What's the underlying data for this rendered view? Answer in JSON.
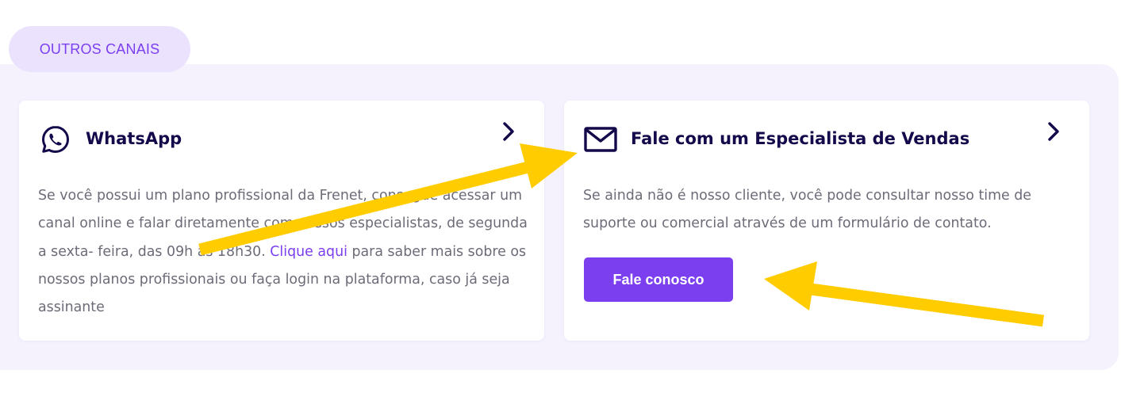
{
  "section": {
    "tag_label": "OUTROS CANAIS"
  },
  "colors": {
    "accent": "#7b3ff0",
    "title": "#14094a",
    "body_text": "#6d6b78",
    "section_background": "#f5f2fe",
    "pill_background": "#ebe3fe",
    "annotation_arrow": "#ffcc00"
  },
  "cards": [
    {
      "icon": "whatsapp-icon",
      "title": "WhatsApp",
      "chevron_icon": "chevron-right-icon",
      "body_lead": "Se você possui um plano profissional da Frenet, consegue acessar um canal online e falar diretamente com nossos especialistas, de segunda a sexta- feira, das 09h às 18h30.",
      "link_text": "Clique aqui",
      "body_tail": "para saber mais sobre os nossos planos profissionais ou faça login na plataforma, caso já seja assinante"
    },
    {
      "icon": "mail-icon",
      "title": "Fale com um Especialista de Vendas",
      "chevron_icon": "chevron-right-icon",
      "body": "Se ainda não é nosso cliente, você pode consultar nosso time de suporte ou comercial através de um formulário de contato.",
      "button_label": "Fale conosco"
    }
  ],
  "annotations": [
    {
      "type": "arrow",
      "color": "yellow",
      "points_to": "card-specialist-title"
    },
    {
      "type": "arrow",
      "color": "yellow",
      "points_to": "fale-conosco-button"
    }
  ]
}
